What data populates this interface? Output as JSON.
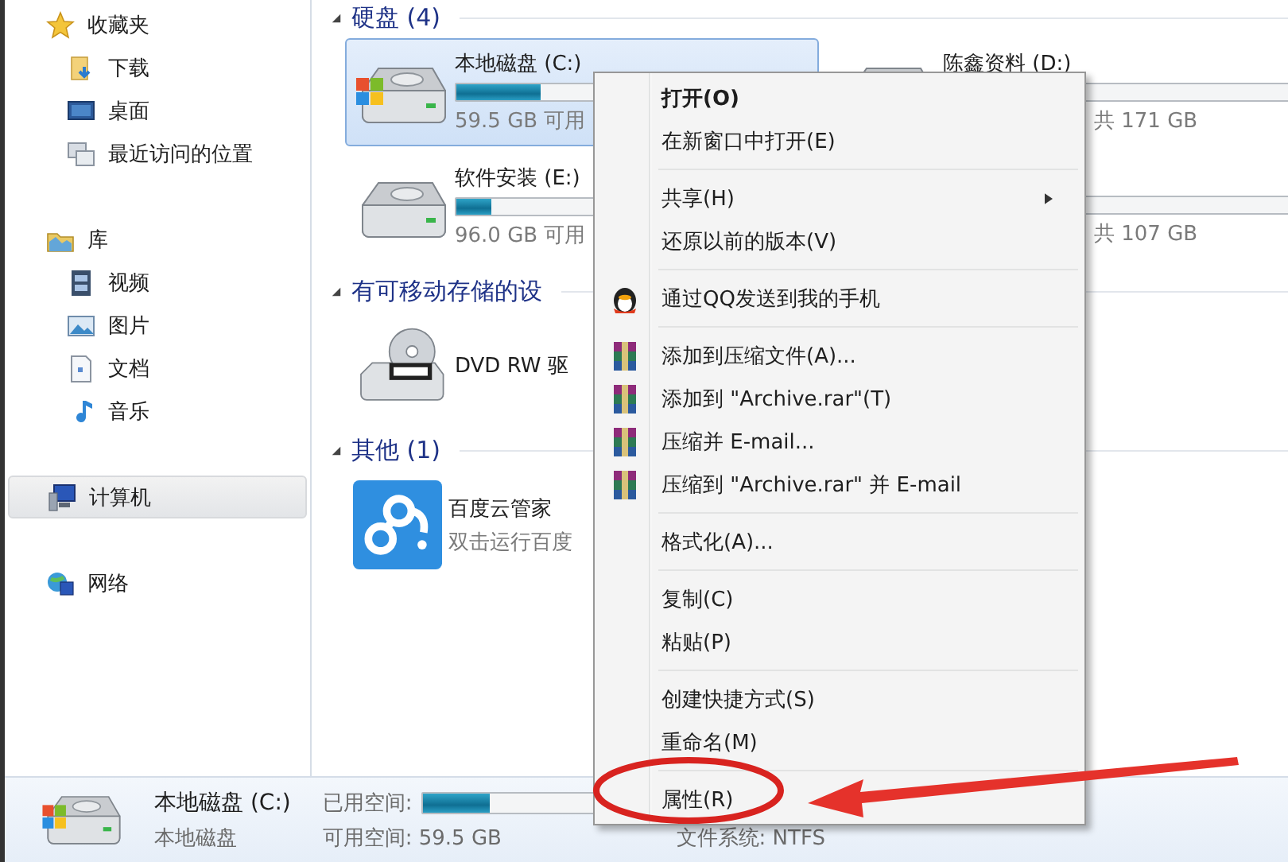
{
  "sidebar": {
    "items": [
      {
        "label": "收藏夹",
        "kind": "favorites",
        "selected": false,
        "children": [
          {
            "label": "下载",
            "kind": "downloads",
            "selected": false
          },
          {
            "label": "桌面",
            "kind": "desktop",
            "selected": false
          },
          {
            "label": "最近访问的位置",
            "kind": "recent",
            "selected": false
          }
        ]
      },
      {
        "label": "库",
        "kind": "library",
        "selected": false,
        "children": [
          {
            "label": "视频",
            "kind": "video",
            "selected": false
          },
          {
            "label": "图片",
            "kind": "pictures",
            "selected": false
          },
          {
            "label": "文档",
            "kind": "documents",
            "selected": false
          },
          {
            "label": "音乐",
            "kind": "music",
            "selected": false
          }
        ]
      },
      {
        "label": "计算机",
        "kind": "computer",
        "selected": true
      },
      {
        "label": "网络",
        "kind": "network",
        "selected": false
      }
    ]
  },
  "sections": [
    {
      "title": "硬盘 (4)",
      "tiles": [
        {
          "kind": "system-drive",
          "name": "本地磁盘 (C:)",
          "level": 0.24,
          "free": "59.5 GB 可用",
          "selected": true
        },
        {
          "kind": "drive",
          "name": "陈鑫资料 (D:)",
          "total": "共 171 GB",
          "selected": false
        },
        {
          "kind": "drive",
          "name": "软件安装 (E:)",
          "level": 0.1,
          "free": "96.0 GB 可用",
          "selected": false
        },
        {
          "kind": "drive",
          "total": "共 107 GB",
          "selected": false
        }
      ]
    },
    {
      "title": "有可移动存储的设",
      "tiles": [
        {
          "kind": "dvd",
          "name": "DVD RW 驱",
          "selected": false
        }
      ]
    },
    {
      "title": "其他 (1)",
      "tiles": [
        {
          "kind": "cloud-app",
          "name": "百度云管家",
          "sub": "双击运行百度",
          "selected": false
        }
      ]
    }
  ],
  "context_menu": {
    "items": [
      {
        "kind": "item",
        "label": "打开(O)",
        "default": true
      },
      {
        "kind": "item",
        "label": "在新窗口中打开(E)"
      },
      {
        "kind": "separator"
      },
      {
        "kind": "item",
        "label": "共享(H)",
        "submenu": true
      },
      {
        "kind": "item",
        "label": "还原以前的版本(V)"
      },
      {
        "kind": "separator"
      },
      {
        "kind": "qq",
        "label": "通过QQ发送到我的手机"
      },
      {
        "kind": "separator"
      },
      {
        "kind": "archive",
        "label": "添加到压缩文件(A)..."
      },
      {
        "kind": "archive",
        "label": "添加到 \"Archive.rar\"(T)"
      },
      {
        "kind": "archive",
        "label": "压缩并 E-mail..."
      },
      {
        "kind": "archive",
        "label": "压缩到 \"Archive.rar\" 并 E-mail"
      },
      {
        "kind": "separator"
      },
      {
        "kind": "item",
        "label": "格式化(A)..."
      },
      {
        "kind": "separator"
      },
      {
        "kind": "item",
        "label": "复制(C)"
      },
      {
        "kind": "item",
        "label": "粘贴(P)"
      },
      {
        "kind": "separator"
      },
      {
        "kind": "item",
        "label": "创建快捷方式(S)"
      },
      {
        "kind": "item",
        "label": "重命名(M)"
      },
      {
        "kind": "separator"
      },
      {
        "kind": "item",
        "label": "属性(R)",
        "circled": true
      }
    ]
  },
  "details": {
    "kind": "system-drive",
    "title": "本地磁盘 (C:)",
    "subtitle": "本地磁盘",
    "used_label": "已用空间:",
    "level": 0.3,
    "free": "可用空间: 59.5 GB",
    "filesystem": "文件系统: NTFS"
  }
}
